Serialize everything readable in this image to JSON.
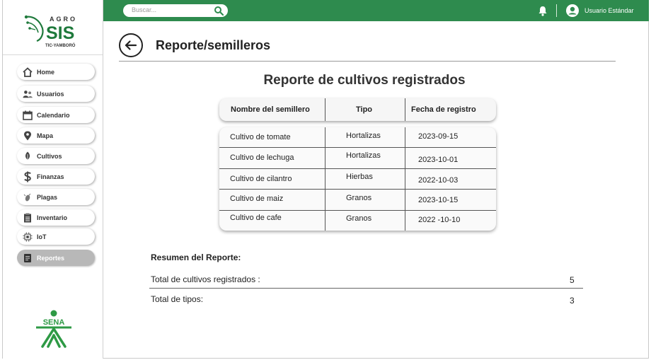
{
  "header": {
    "search_placeholder": "Buscar...",
    "user_name": "Usuario Estándar"
  },
  "brand": {
    "logo_top": "AGRO",
    "logo_main": "SIS",
    "logo_sub": "TIC-YAMBORÓ",
    "footer_logo": "SENA"
  },
  "sidebar": {
    "items": [
      {
        "label": "Home",
        "icon": "home-icon"
      },
      {
        "label": "Usuarios",
        "icon": "users-icon"
      },
      {
        "label": "Calendario",
        "icon": "calendar-icon"
      },
      {
        "label": "Mapa",
        "icon": "map-pin-icon"
      },
      {
        "label": "Cultivos",
        "icon": "leaf-icon"
      },
      {
        "label": "Finanzas",
        "icon": "dollar-icon"
      },
      {
        "label": "Plagas",
        "icon": "bug-icon"
      },
      {
        "label": "Inventario",
        "icon": "clipboard-icon"
      },
      {
        "label": "IoT",
        "icon": "chip-icon"
      },
      {
        "label": "Reportes",
        "icon": "report-icon",
        "active": true
      }
    ]
  },
  "main": {
    "page_title": "Reporte/semilleros",
    "report_title": "Reporte de cultivos registrados",
    "table": {
      "headers": [
        "Nombre del semillero",
        "Tipo",
        "Fecha de registro"
      ],
      "rows": [
        [
          "Cultivo de tomate",
          "Hortalizas",
          "2023-09-15"
        ],
        [
          "Cultivo de lechuga",
          "Hortalizas",
          "2023-10-01"
        ],
        [
          "Cultivo de cilantro",
          "Hierbas",
          "2022-10-03"
        ],
        [
          "Cultivo de maiz",
          "Granos",
          "2023-10-15"
        ],
        [
          "Cultivo de cafe",
          "Granos",
          "2022 -10-10"
        ]
      ]
    },
    "summary": {
      "title": "Resumen del Reporte:",
      "items": [
        {
          "label": "Total de cultivos registrados :",
          "value": "5"
        },
        {
          "label": "Total de tipos:",
          "value": "3"
        }
      ]
    }
  },
  "colors": {
    "topbar": "#2e8b4e",
    "brand_green": "#1f7a3c",
    "active_nav": "#b8b8b8"
  }
}
